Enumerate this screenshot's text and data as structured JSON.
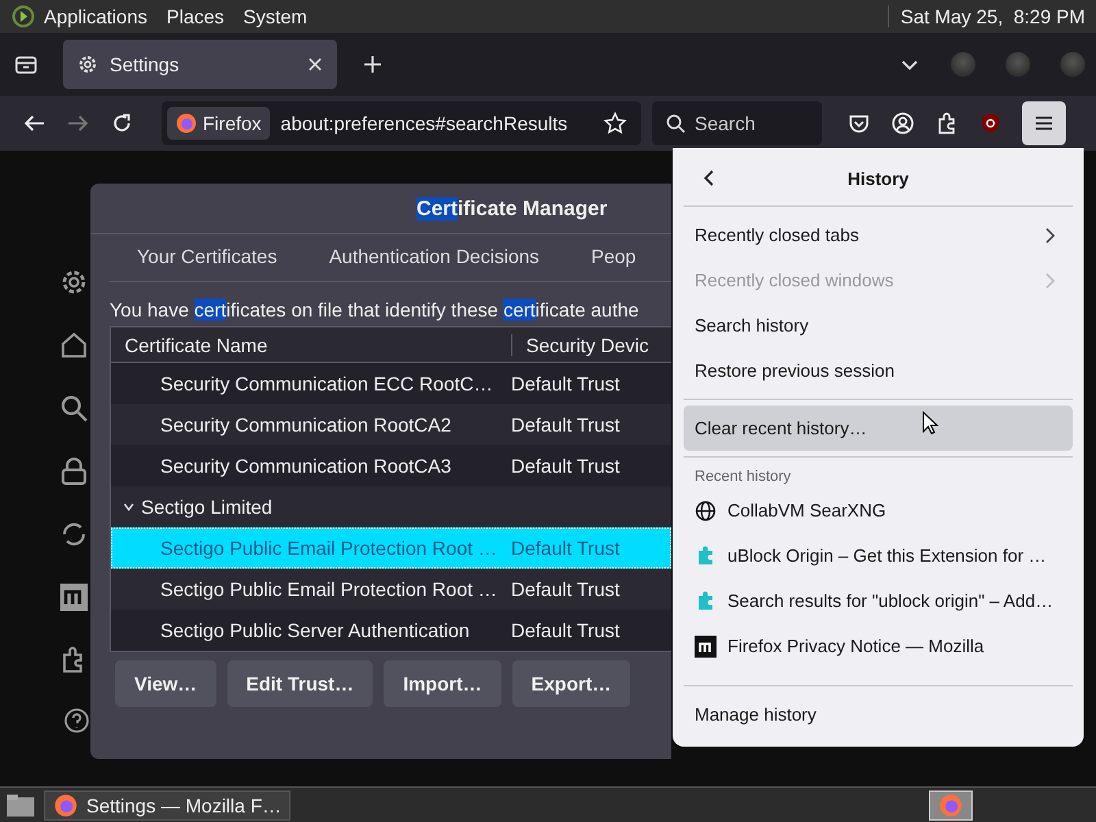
{
  "top_panel": {
    "menus": [
      "Applications",
      "Places",
      "System"
    ],
    "clock": "Sat May 25,  8:29 PM"
  },
  "tabs": [
    {
      "label": "Settings",
      "selected": true
    }
  ],
  "navbar": {
    "identity": "Firefox",
    "url": "about:preferences#searchResults",
    "search": {
      "placeholder": "Search"
    }
  },
  "dialog": {
    "title": [
      {
        "text": "Cert",
        "highlighted": true
      },
      {
        "text": "ificate Manager",
        "highlighted": false
      }
    ],
    "tabs": [
      {
        "label": "Your Certificates",
        "selected": false
      },
      {
        "label": "Authentication Decisions",
        "selected": false
      },
      {
        "label": "Peop",
        "selected": false
      }
    ],
    "description": [
      {
        "text": "You have ",
        "highlighted": false
      },
      {
        "text": "cert",
        "highlighted": true
      },
      {
        "text": "ificates on file that identify these ",
        "highlighted": false
      },
      {
        "text": "cert",
        "highlighted": true
      },
      {
        "text": "ificate authe",
        "highlighted": false
      }
    ],
    "table": {
      "columns": [
        "Certificate Name",
        "Security Devic"
      ],
      "rows": [
        {
          "kind": "cert",
          "name": "Security Communication ECC RootC…",
          "device": "Default Trust",
          "selected": false
        },
        {
          "kind": "cert",
          "name": "Security Communication RootCA2",
          "device": "Default Trust",
          "selected": false
        },
        {
          "kind": "cert",
          "name": "Security Communication RootCA3",
          "device": "Default Trust",
          "selected": false
        },
        {
          "kind": "group",
          "name": "Sectigo Limited",
          "expanded": true,
          "selected": false
        },
        {
          "kind": "cert",
          "name": "Sectigo Public Email Protection Root …",
          "device": "Default Trust",
          "selected": true
        },
        {
          "kind": "cert",
          "name": "Sectigo Public Email Protection Root …",
          "device": "Default Trust",
          "selected": false
        },
        {
          "kind": "cert",
          "name": "Sectigo Public Server Authentication",
          "device": "Default Trust",
          "selected": false
        }
      ]
    },
    "buttons": [
      "View…",
      "Edit Trust…",
      "Import…",
      "Export…"
    ]
  },
  "history_menu": {
    "title": "History",
    "groups": [
      [
        {
          "label": "Recently closed tabs",
          "submenu": true,
          "disabled": false,
          "hovered": false
        },
        {
          "label": "Recently closed windows",
          "submenu": true,
          "disabled": true,
          "hovered": false
        },
        {
          "label": "Search history",
          "submenu": false,
          "disabled": false,
          "hovered": false
        },
        {
          "label": "Restore previous session",
          "submenu": false,
          "disabled": false,
          "hovered": false
        }
      ],
      [
        {
          "label": "Clear recent history…",
          "submenu": false,
          "disabled": false,
          "hovered": true
        }
      ]
    ],
    "section_label": "Recent history",
    "recent": [
      {
        "kind": "globe",
        "title": "CollabVM SearXNG"
      },
      {
        "kind": "puzzle",
        "title": "uBlock Origin – Get this Extension for …"
      },
      {
        "kind": "puzzle",
        "title": "Search results for \"ublock origin\" – Add…"
      },
      {
        "kind": "mozilla",
        "title": "Firefox Privacy Notice — Mozilla"
      }
    ],
    "footer": "Manage history"
  },
  "taskbar": {
    "window": "Settings — Mozilla F…"
  }
}
